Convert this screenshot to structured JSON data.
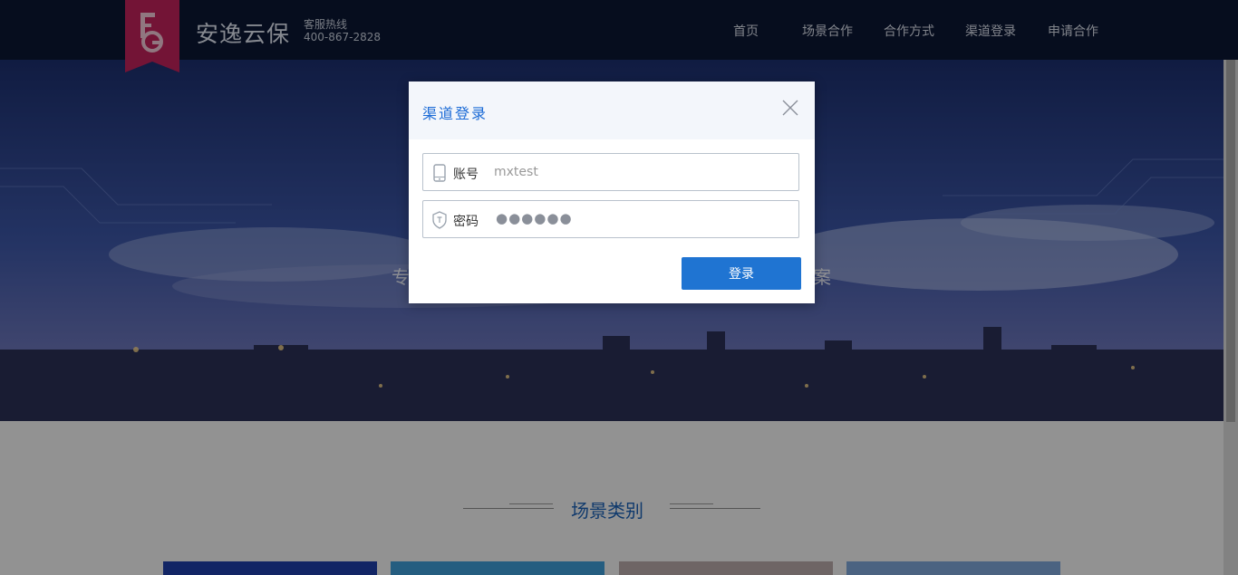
{
  "header": {
    "brand": "安逸云保",
    "hotline_label": "客服热线",
    "hotline_number": "400-867-2828",
    "nav": [
      {
        "label": "首页"
      },
      {
        "label": "场景合作"
      },
      {
        "label": "合作方式"
      },
      {
        "label": "渠道登录"
      },
      {
        "label": "申请合作"
      }
    ]
  },
  "hero": {
    "text_left": "专",
    "text_right": "案"
  },
  "section": {
    "title": "场景类别"
  },
  "login_dialog": {
    "title": "渠道登录",
    "account_label": "账号",
    "account_value": "mxtest",
    "password_label": "密码",
    "password_mask": "●●●●●●",
    "submit_label": "登录"
  },
  "icons": {
    "close": "close-icon",
    "phone": "phone-icon",
    "shield": "shield-icon"
  },
  "colors": {
    "header_bg": "#0a1633",
    "accent": "#1f74d2",
    "logo": "#c0225a",
    "title_blue": "#1a5fb4"
  }
}
